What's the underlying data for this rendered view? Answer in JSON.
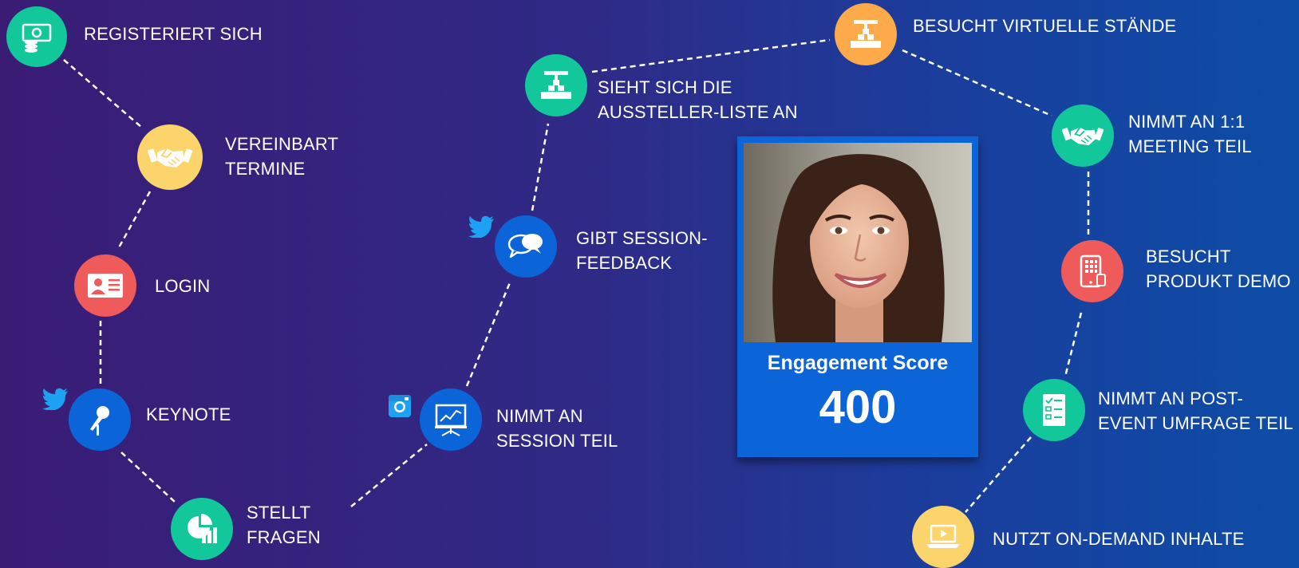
{
  "colors": {
    "teal": "#12c79a",
    "yellow": "#fcd46c",
    "red": "#ef5b5b",
    "blue": "#0c64d9",
    "orange": "#fdab4a",
    "twitter": "#1da1f2",
    "card": "#0c64d9"
  },
  "steps": [
    {
      "id": "registriert",
      "label": "REGISTERIERT SICH",
      "icon": "money-icon",
      "color": "teal"
    },
    {
      "id": "vereinbart",
      "label": "VEREINBART TERMINE",
      "icon": "handshake-icon",
      "color": "yellow"
    },
    {
      "id": "login",
      "label": "LOGIN",
      "icon": "id-card-icon",
      "color": "red"
    },
    {
      "id": "keynote",
      "label": "KEYNOTE",
      "icon": "microphone-icon",
      "color": "blue"
    },
    {
      "id": "fragen",
      "label": "STELLT FRAGEN",
      "icon": "chart-icon",
      "color": "teal"
    },
    {
      "id": "session",
      "label": "NIMMT AN SESSION TEIL",
      "icon": "presentation-icon",
      "color": "blue"
    },
    {
      "id": "feedback",
      "label": "GIBT SESSION-FEEDBACK",
      "icon": "chat-bubbles-icon",
      "color": "blue"
    },
    {
      "id": "aussteller",
      "label": "SIEHT SICH DIE AUSSTELLER-LISTE AN",
      "icon": "booth-icon",
      "color": "teal"
    },
    {
      "id": "staende",
      "label": "BESUCHT VIRTUELLE STÄNDE",
      "icon": "booth-icon",
      "color": "orange"
    },
    {
      "id": "meeting",
      "label": "NIMMT AN 1:1 MEETING TEIL",
      "icon": "handshake-icon",
      "color": "teal"
    },
    {
      "id": "demo",
      "label": "BESUCHT PRODUKT DEMO",
      "icon": "tablet-icon",
      "color": "red"
    },
    {
      "id": "umfrage",
      "label": "NIMMT AN POST-EVENT UMFRAGE TEIL",
      "icon": "checklist-icon",
      "color": "teal"
    },
    {
      "id": "ondemand",
      "label": "NUTZT ON-DEMAND INHALTE",
      "icon": "video-laptop-icon",
      "color": "yellow"
    }
  ],
  "labels": {
    "registriert": [
      "REGISTERIERT SICH"
    ],
    "vereinbart": [
      "VEREINBART",
      "TERMINE"
    ],
    "login": [
      "LOGIN"
    ],
    "keynote": [
      "KEYNOTE"
    ],
    "fragen": [
      "STELLT",
      "FRAGEN"
    ],
    "session": [
      "NIMMT AN",
      "SESSION TEIL"
    ],
    "feedback": [
      "GIBT SESSION-",
      "FEEDBACK"
    ],
    "aussteller": [
      "SIEHT SICH DIE",
      "AUSSTELLER-LISTE AN"
    ],
    "staende": [
      "BESUCHT VIRTUELLE STÄNDE"
    ],
    "meeting": [
      "NIMMT AN 1:1",
      "MEETING TEIL"
    ],
    "demo": [
      "BESUCHT",
      "PRODUKT DEMO"
    ],
    "umfrage": [
      "NIMMT AN POST-",
      "EVENT UMFRAGE TEIL"
    ],
    "ondemand": [
      "NUTZT ON-DEMAND INHALTE"
    ]
  },
  "social": {
    "keynote": "twitter-icon",
    "feedback": "twitter-icon",
    "session": "instagram-icon"
  },
  "score_card": {
    "title": "Engagement Score",
    "value": "400"
  }
}
